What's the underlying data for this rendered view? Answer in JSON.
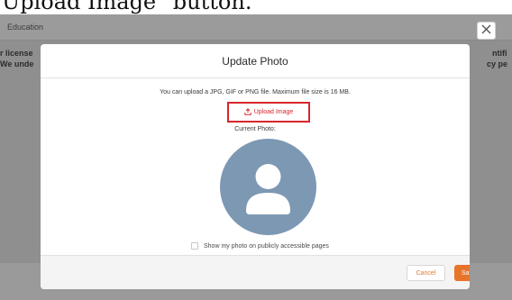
{
  "caption": {
    "text": "Upload Image\" button."
  },
  "background": {
    "section_title": "Education",
    "left_line_1": "r license",
    "left_line_2": "We unde",
    "right_line_1": "ntifi",
    "right_line_2": "cy pe"
  },
  "modal": {
    "title": "Update Photo",
    "info": "You can upload a JPG, GIF or PNG file. Maximum file size is 16 MB.",
    "upload_label": "Upload Image",
    "upload_icon": "upload-icon",
    "current_photo_label": "Current Photo:",
    "avatar_icon": "user-avatar-icon",
    "checkbox_label": "Show my photo on publicly accessible pages",
    "checkbox_checked": false,
    "cancel_label": "Cancel",
    "save_label": "Save",
    "close_icon": "close-icon"
  },
  "colors": {
    "highlight_border": "#d8262b",
    "save_button": "#e8742b",
    "avatar_bg": "#7d98b3",
    "overlay": "#8f8f8f"
  }
}
